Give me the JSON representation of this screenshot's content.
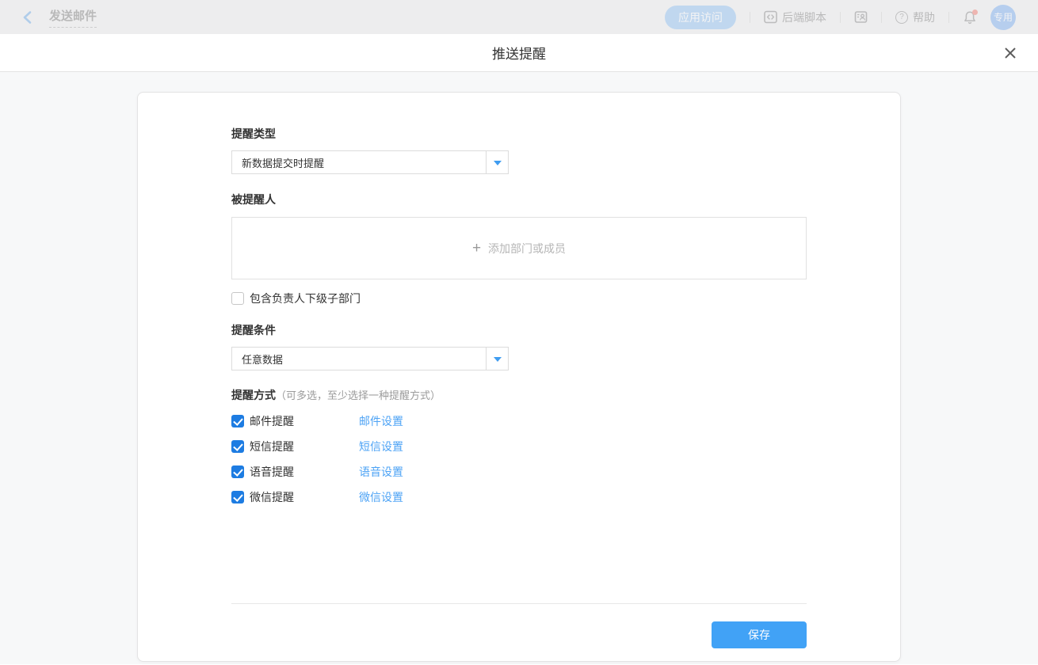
{
  "topbar": {
    "back_label": "发送邮件",
    "app_access_label": "应用访问",
    "backend_script_label": "后端脚本",
    "help_label": "帮助",
    "avatar_label": "专用"
  },
  "modal": {
    "title": "推送提醒"
  },
  "form": {
    "reminder_type": {
      "label": "提醒类型",
      "value": "新数据提交时提醒"
    },
    "reminded_people": {
      "label": "被提醒人",
      "add_placeholder": "添加部门或成员",
      "plus_glyph": "+",
      "include_sub": {
        "label": "包含负责人下级子部门",
        "checked": false
      }
    },
    "reminder_condition": {
      "label": "提醒条件",
      "value": "任意数据"
    },
    "reminder_methods": {
      "label": "提醒方式",
      "hint": "（可多选，至少选择一种提醒方式）",
      "items": [
        {
          "label": "邮件提醒",
          "checked": true,
          "link": "邮件设置"
        },
        {
          "label": "短信提醒",
          "checked": true,
          "link": "短信设置"
        },
        {
          "label": "语音提醒",
          "checked": true,
          "link": "语音设置"
        },
        {
          "label": "微信提醒",
          "checked": true,
          "link": "微信设置"
        }
      ]
    },
    "save_label": "保存"
  },
  "colors": {
    "accent_blue": "#1d7ce2",
    "link_blue": "#4da3f5",
    "save_blue": "#41a2f6",
    "caret_blue": "#3f9cf0",
    "notification_red": "#f25d50"
  }
}
